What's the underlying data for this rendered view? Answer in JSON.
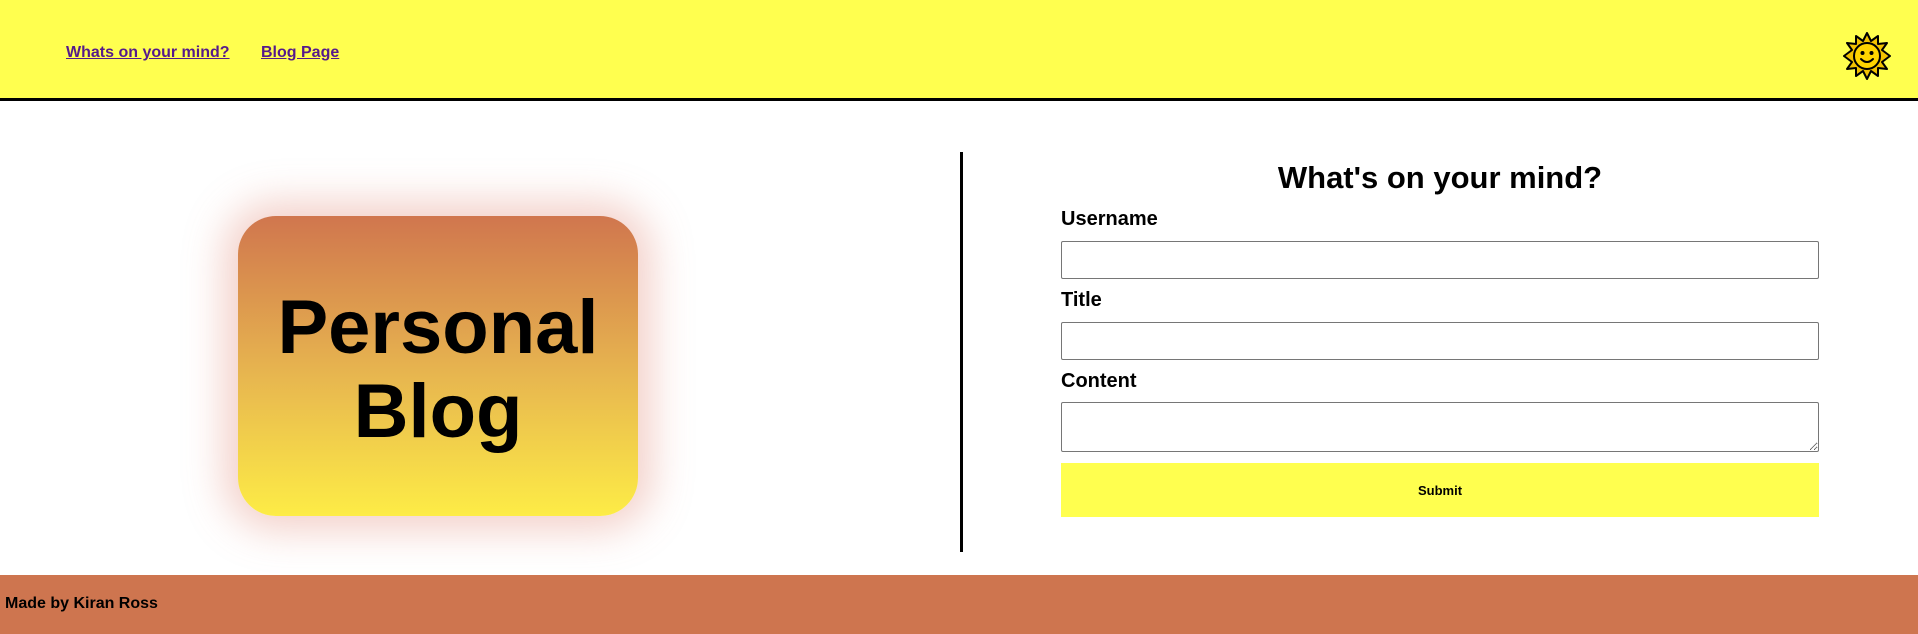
{
  "nav": {
    "links": [
      {
        "label": "Whats on your mind?"
      },
      {
        "label": "Blog Page"
      }
    ],
    "theme_icon": "sun-face-icon"
  },
  "hero": {
    "logo_text": "Personal\nBlog"
  },
  "form": {
    "title": "What's on your mind?",
    "username_label": "Username",
    "username_value": "",
    "title_label": "Title",
    "title_value": "",
    "content_label": "Content",
    "content_value": "",
    "submit_label": "Submit"
  },
  "footer": {
    "text": "Made by Kiran Ross"
  },
  "colors": {
    "header_bg": "#ffff4f",
    "footer_bg": "#ce754f",
    "accent_orange": "#d0764e",
    "accent_yellow": "#fdec46"
  }
}
